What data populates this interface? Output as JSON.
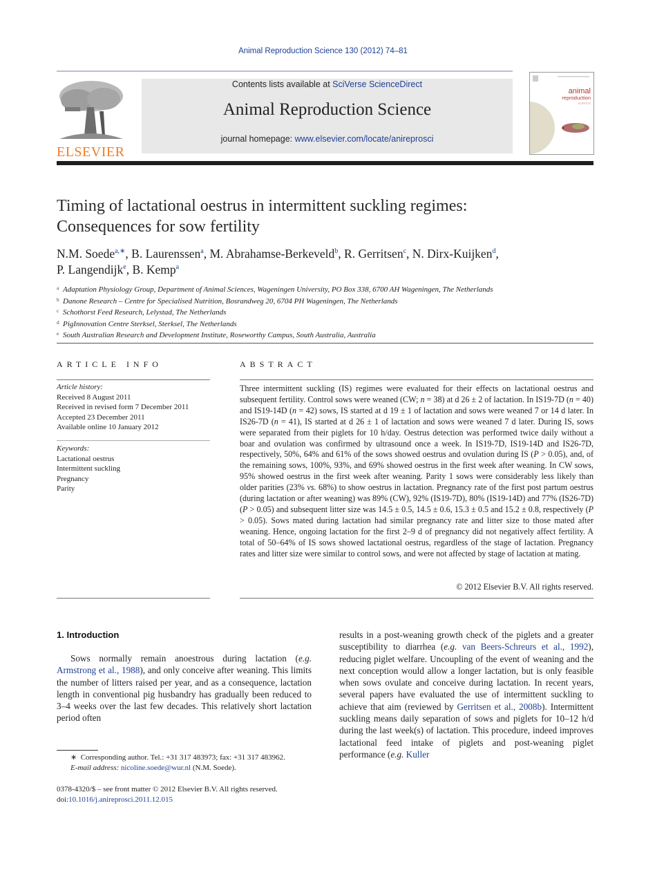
{
  "running_head": "Animal Reproduction Science 130 (2012) 74–81",
  "publisher": {
    "logo_text": "ELSEVIER",
    "logo_color": "#f07b26"
  },
  "banner": {
    "contents_prefix": "Contents lists available at ",
    "contents_link": "SciVerse ScienceDirect",
    "journal_name": "Animal Reproduction Science",
    "homepage_prefix": "journal homepage: ",
    "homepage_link": "www.elsevier.com/locate/anireprosci"
  },
  "cover": {
    "line1": "animal",
    "line2": "reproduction",
    "line3": "science"
  },
  "article": {
    "title_line1": "Timing of lactational oestrus in intermittent suckling regimes:",
    "title_line2": "Consequences for sow fertility",
    "authors": [
      {
        "name": "N.M. Soede",
        "sup": "a,∗",
        "sep": ", "
      },
      {
        "name": "B. Laurenssen",
        "sup": "a",
        "sep": ", "
      },
      {
        "name": "M. Abrahamse-Berkeveld",
        "sup": "b",
        "sep": ", "
      },
      {
        "name": "R. Gerritsen",
        "sup": "c",
        "sep": ", "
      },
      {
        "name": "N. Dirx-Kuijken",
        "sup": "d",
        "sep": ","
      },
      {
        "name": "P. Langendijk",
        "sup": "e",
        "sep": ", "
      },
      {
        "name": "B. Kemp",
        "sup": "a",
        "sep": ""
      }
    ],
    "affiliations": [
      {
        "mark": "a",
        "text": "Adaptation Physiology Group, Department of Animal Sciences, Wageningen University, PO Box 338, 6700 AH Wageningen, The Netherlands"
      },
      {
        "mark": "b",
        "text": "Danone Research – Centre for Specialised Nutrition, Bosrandweg 20, 6704 PH Wageningen, The Netherlands"
      },
      {
        "mark": "c",
        "text": "Schothorst Feed Research, Lelystad, The Netherlands"
      },
      {
        "mark": "d",
        "text": "PigInnovation Centre Sterksel, Sterksel, The Netherlands"
      },
      {
        "mark": "e",
        "text": "South Australian Research and Development Institute, Roseworthy Campus, South Australia, Australia"
      }
    ]
  },
  "article_info": {
    "heading": "ARTICLE INFO",
    "history_label": "Article history:",
    "history": [
      "Received 8 August 2011",
      "Received in revised form 7 December 2011",
      "Accepted 23 December 2011",
      "Available online 10 January 2012"
    ],
    "keywords_label": "Keywords:",
    "keywords": [
      "Lactational oestrus",
      "Intermittent suckling",
      "Pregnancy",
      "Parity"
    ]
  },
  "abstract": {
    "heading": "ABSTRACT",
    "text": "Three intermittent suckling (IS) regimes were evaluated for their effects on lactational oestrus and subsequent fertility. Control sows were weaned (CW; n = 38) at d 26 ± 2 of lactation. In IS19-7D (n = 40) and IS19-14D (n = 42) sows, IS started at d 19 ± 1 of lactation and sows were weaned 7 or 14 d later. In IS26-7D (n = 41), IS started at d 26 ± 1 of lactation and sows were weaned 7 d later. During IS, sows were separated from their piglets for 10 h/day. Oestrus detection was performed twice daily without a boar and ovulation was confirmed by ultrasound once a week. In IS19-7D, IS19-14D and IS26-7D, respectively, 50%, 64% and 61% of the sows showed oestrus and ovulation during IS (P > 0.05), and, of the remaining sows, 100%, 93%, and 69% showed oestrus in the first week after weaning. In CW sows, 95% showed oestrus in the first week after weaning. Parity 1 sows were considerably less likely than older parities (23% vs. 68%) to show oestrus in lactation. Pregnancy rate of the first post partum oestrus (during lactation or after weaning) was 89% (CW), 92% (IS19-7D), 80% (IS19-14D) and 77% (IS26-7D) (P > 0.05) and subsequent litter size was 14.5 ± 0.5, 14.5 ± 0.6, 15.3 ± 0.5 and 15.2 ± 0.8, respectively (P > 0.05). Sows mated during lactation had similar pregnancy rate and litter size to those mated after weaning. Hence, ongoing lactation for the first 2–9 d of pregnancy did not negatively affect fertility. A total of 50–64% of IS sows showed lactational oestrus, regardless of the stage of lactation. Pregnancy rates and litter size were similar to control sows, and were not affected by stage of lactation at mating.",
    "copyright": "© 2012 Elsevier B.V. All rights reserved."
  },
  "introduction": {
    "heading": "1.  Introduction",
    "left_parts": [
      {
        "t": "Sows normally remain anoestrous during lactation ("
      },
      {
        "t": "e.g.",
        "i": true
      },
      {
        "t": " "
      },
      {
        "t": "Armstrong et al., 1988",
        "link": true
      },
      {
        "t": "), and only conceive after weaning. This limits the number of litters raised per year, and as a consequence, lactation length in conventional pig husbandry has gradually been reduced to 3–4 weeks over the last few decades. This relatively short lactation period often"
      }
    ],
    "right_parts": [
      {
        "t": "results in a post-weaning growth check of the piglets and a greater susceptibility to diarrhea ("
      },
      {
        "t": "e.g.",
        "i": true
      },
      {
        "t": " "
      },
      {
        "t": "van Beers-Schreurs et al., 1992",
        "link": true
      },
      {
        "t": "), reducing piglet welfare. Uncoupling of the event of weaning and the next conception would allow a longer lactation, but is only feasible when sows ovulate and conceive during lactation. In recent years, several papers have evaluated the use of intermittent suckling to achieve that aim (reviewed by "
      },
      {
        "t": "Gerritsen et al., 2008b",
        "link": true
      },
      {
        "t": "). Intermittent suckling means daily separation of sows and piglets for 10–12 h/d during the last week(s) of lactation. This procedure, indeed improves lactational feed intake of piglets and post-weaning piglet performance ("
      },
      {
        "t": "e.g.",
        "i": true
      },
      {
        "t": " "
      },
      {
        "t": "Kuller",
        "link": true
      }
    ]
  },
  "footnote": {
    "marker": "∗",
    "corresponding": "Corresponding author. Tel.: +31 317 483973; fax: +31 317 483962.",
    "email_label": "E-mail address:",
    "email": "nicoline.soede@wur.nl",
    "email_suffix": " (N.M. Soede)."
  },
  "issn": {
    "line1": "0378-4320/$ – see front matter © 2012 Elsevier B.V. All rights reserved.",
    "doi_prefix": "doi:",
    "doi": "10.1016/j.anireprosci.2011.12.015"
  }
}
